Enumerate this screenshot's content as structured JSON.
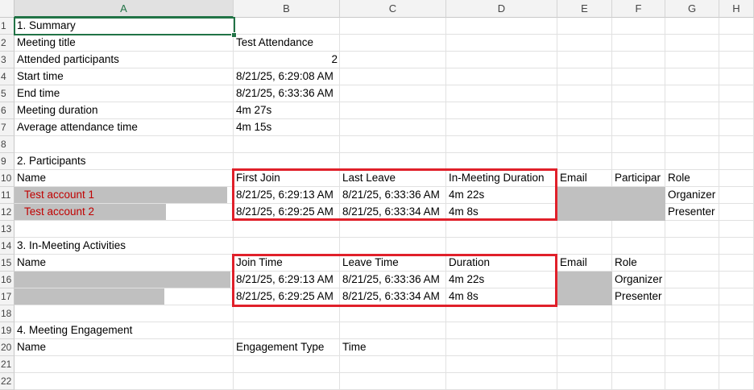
{
  "columns": [
    "A",
    "B",
    "C",
    "D",
    "E",
    "F",
    "G",
    "H"
  ],
  "rows": [
    "1",
    "2",
    "3",
    "4",
    "5",
    "6",
    "7",
    "8",
    "9",
    "10",
    "11",
    "12",
    "13",
    "14",
    "15",
    "16",
    "17",
    "18",
    "19",
    "20",
    "21",
    "22"
  ],
  "summary": {
    "heading": "1. Summary",
    "meeting_title_label": "Meeting title",
    "meeting_title": "Test Attendance",
    "attended_label": "Attended participants",
    "attended": "2",
    "start_label": "Start time",
    "start": "8/21/25, 6:29:08 AM",
    "end_label": "End time",
    "end": "8/21/25, 6:33:36 AM",
    "duration_label": "Meeting duration",
    "duration": "4m 27s",
    "avg_label": "Average attendance time",
    "avg": "4m 15s"
  },
  "participants": {
    "heading": "2. Participants",
    "headers": [
      "Name",
      "First Join",
      "Last Leave",
      "In-Meeting Duration",
      "Email",
      "Participar",
      "Role"
    ],
    "rows": [
      {
        "name": "Test account 1",
        "first_join": "8/21/25, 6:29:13 AM",
        "last_leave": "8/21/25, 6:33:36 AM",
        "duration": "4m 22s",
        "role": "Organizer"
      },
      {
        "name": "Test account 2",
        "first_join": "8/21/25, 6:29:25 AM",
        "last_leave": "8/21/25, 6:33:34 AM",
        "duration": "4m 8s",
        "role": "Presenter"
      }
    ]
  },
  "activities": {
    "heading": "3. In-Meeting Activities",
    "headers": [
      "Name",
      "Join Time",
      "Leave Time",
      "Duration",
      "Email",
      "Role"
    ],
    "rows": [
      {
        "join": "8/21/25, 6:29:13 AM",
        "leave": "8/21/25, 6:33:36 AM",
        "duration": "4m 22s",
        "role": "Organizer"
      },
      {
        "join": "8/21/25, 6:29:25 AM",
        "leave": "8/21/25, 6:33:34 AM",
        "duration": "4m 8s",
        "role": "Presenter"
      }
    ]
  },
  "engagement": {
    "heading": "4. Meeting Engagement",
    "headers": [
      "Name",
      "Engagement Type",
      "Time"
    ]
  },
  "colors": {
    "highlight_box": "#e0202a",
    "redacted": "#c0c0c0",
    "selection": "#217346",
    "name_text": "#c00000"
  }
}
